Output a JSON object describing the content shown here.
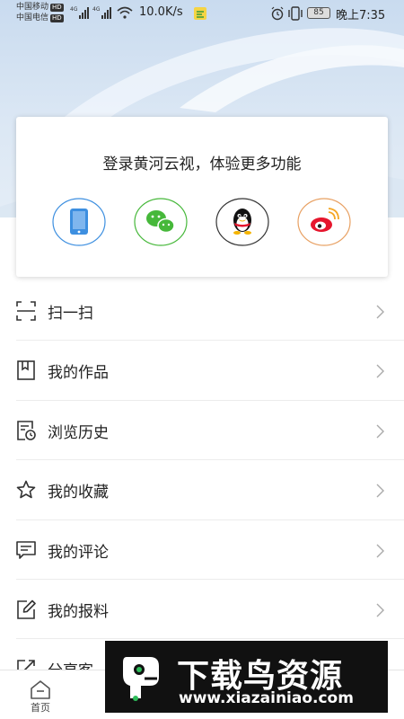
{
  "status_bar": {
    "carrier1": "中国移动",
    "carrier2": "中国电信",
    "hd1": "HD",
    "hd2": "HD",
    "net1": "4G",
    "net2": "4G",
    "speed": "10.0K/s",
    "battery": "85",
    "time": "晚上7:35"
  },
  "login_card": {
    "title": "登录黄河云视，体验更多功能",
    "options": [
      {
        "icon": "phone-icon",
        "color": "#3d8fe0"
      },
      {
        "icon": "wechat-icon",
        "color": "#46b83a"
      },
      {
        "icon": "qq-icon",
        "color": "#111111"
      },
      {
        "icon": "weibo-icon",
        "color": "#e6162d"
      }
    ]
  },
  "menu": {
    "items": [
      {
        "label": "扫一扫",
        "icon": "scan-icon"
      },
      {
        "label": "我的作品",
        "icon": "bookmark-icon"
      },
      {
        "label": "浏览历史",
        "icon": "history-icon"
      },
      {
        "label": "我的收藏",
        "icon": "star-icon"
      },
      {
        "label": "我的评论",
        "icon": "comment-icon"
      },
      {
        "label": "我的报料",
        "icon": "edit-icon"
      },
      {
        "label": "分享客",
        "icon": "share-icon"
      }
    ]
  },
  "tabbar": {
    "home_label": "首页"
  },
  "watermark": {
    "title": "下载鸟资源",
    "url": "www.xiazainiao.com"
  }
}
